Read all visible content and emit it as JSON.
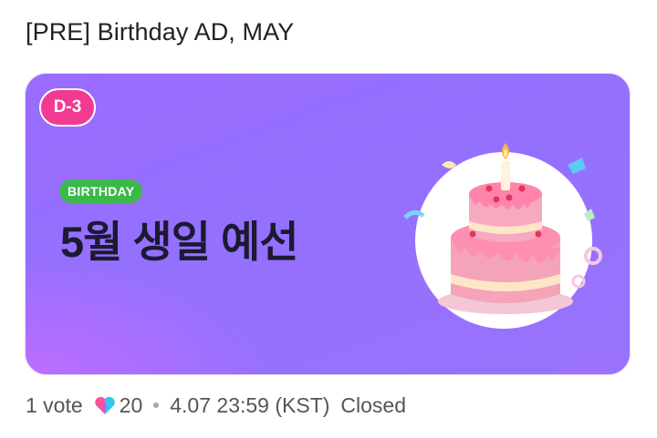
{
  "post": {
    "title": "[PRE] Birthday AD, MAY"
  },
  "banner": {
    "dday_badge": "D-3",
    "category_pill": "BIRTHDAY",
    "headline": "5월 생일 예선",
    "illustration": "birthday-cake-icon"
  },
  "footer": {
    "votes": "1 vote",
    "heart_icon": "heart-icon",
    "likes": "20",
    "deadline": "4.07 23:59 (KST)",
    "status": "Closed"
  },
  "colors": {
    "banner_gradient_start": "#9a6cff",
    "banner_gradient_accent": "#c46cff",
    "dday_badge": "#f23a93",
    "birthday_pill": "#3cb84a",
    "heart_left": "#ff4fa3",
    "heart_right": "#33c6f0"
  }
}
